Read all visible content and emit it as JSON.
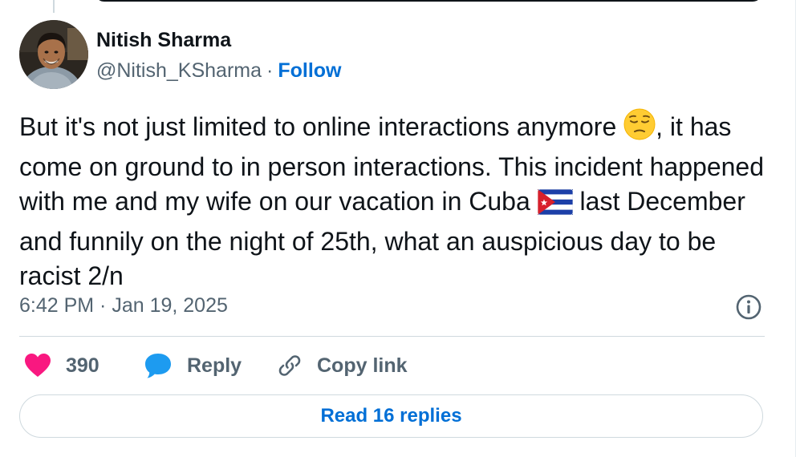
{
  "author": {
    "display_name": "Nitish Sharma",
    "handle": "@Nitish_KSharma",
    "separator": "·",
    "follow_label": "Follow"
  },
  "tweet": {
    "segment_1": "But it's not just limited to online interactions anymore ",
    "emoji_1": "pensive-face-emoji",
    "segment_2": ", it has come on ground to in person interactions. This incident happened with me and my wife on our vacation in Cuba ",
    "emoji_2": "cuba-flag-emoji",
    "segment_3": " last December and funnily on the night of 25th, what an auspicious day to be racist 2/n"
  },
  "meta": {
    "timestamp": "6:42 PM · Jan 19, 2025"
  },
  "actions": {
    "like_count": "390",
    "reply_label": "Reply",
    "copy_link_label": "Copy link"
  },
  "replies": {
    "read_label": "Read 16 replies"
  },
  "colors": {
    "link_blue": "#006fd6",
    "like_pink": "#f91880",
    "reply_blue": "#1d9bf0",
    "secondary_text": "#536471",
    "border": "#cfd9de"
  },
  "icons": {
    "like": "heart-icon",
    "reply": "speech-bubble-icon",
    "copy_link": "link-icon",
    "info": "info-icon"
  }
}
